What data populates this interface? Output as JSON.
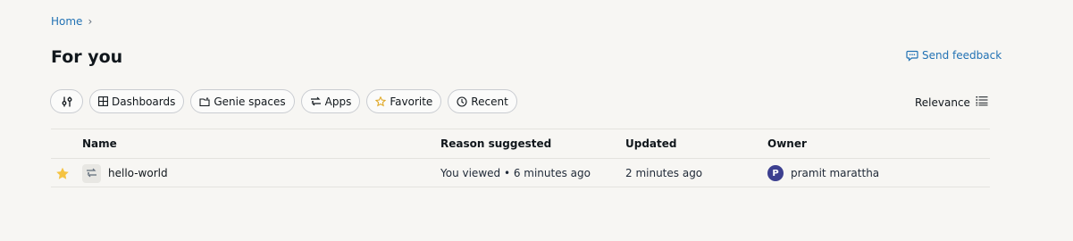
{
  "breadcrumb": {
    "home": "Home",
    "separator": "›"
  },
  "page_title": "For you",
  "feedback": {
    "label": "Send feedback",
    "icon": "chat-bubble-icon"
  },
  "filters": [
    {
      "id": "filter-settings",
      "label": "",
      "icon": "sliders-icon"
    },
    {
      "id": "dashboards",
      "label": "Dashboards",
      "icon": "grid-icon"
    },
    {
      "id": "genie-spaces",
      "label": "Genie spaces",
      "icon": "genie-icon"
    },
    {
      "id": "apps",
      "label": "Apps",
      "icon": "apps-icon"
    },
    {
      "id": "favorite",
      "label": "Favorite",
      "icon": "star-outline-icon"
    },
    {
      "id": "recent",
      "label": "Recent",
      "icon": "clock-icon"
    }
  ],
  "sort": {
    "label": "Relevance",
    "icon": "list-icon"
  },
  "table": {
    "columns": {
      "name": "Name",
      "reason": "Reason suggested",
      "updated": "Updated",
      "owner": "Owner"
    },
    "rows": [
      {
        "favorite": true,
        "type_icon": "apps-icon",
        "name": "hello-world",
        "reason": "You viewed • 6 minutes ago",
        "updated": "2 minutes ago",
        "owner_initial": "P",
        "owner": "pramit marattha"
      }
    ]
  },
  "colors": {
    "background": "#f7f6f3",
    "link": "#2272b4",
    "star": "#f5c342",
    "avatar": "#3c3f8f"
  }
}
